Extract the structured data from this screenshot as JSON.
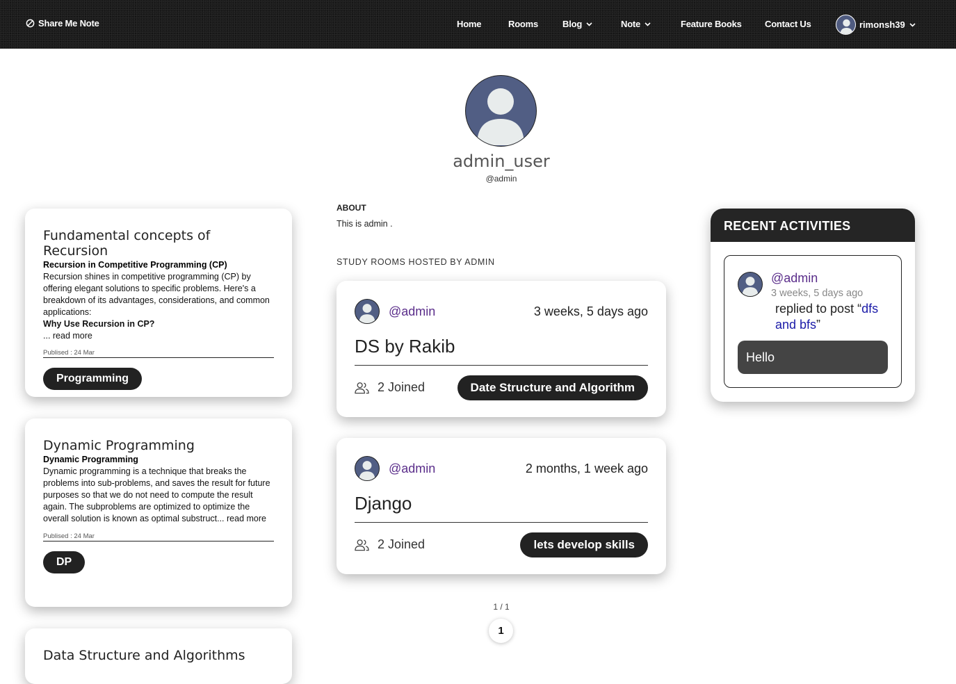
{
  "nav": {
    "brand": "Share Me Note",
    "items": [
      {
        "label": "Home"
      },
      {
        "label": "Rooms"
      },
      {
        "label": "Blog"
      },
      {
        "label": "Note"
      },
      {
        "label": "Feature Books"
      },
      {
        "label": "Contact Us"
      }
    ],
    "user": "rimonsh39",
    "icons": {
      "brand": "leaf-logo-icon",
      "dropdown": "chevron-down-icon",
      "avatar": "default-user-avatar"
    }
  },
  "profile": {
    "name": "admin_user",
    "handle": "@admin"
  },
  "about": {
    "label": "ABOUT",
    "text": "This is admin ."
  },
  "rooms": {
    "label": "STUDY ROOMS HOSTED BY ADMIN",
    "items": [
      {
        "host": "@admin",
        "time": "3 weeks, 5 days ago",
        "title": "DS by Rakib",
        "joined": "2 Joined",
        "topic": "Date Structure and Algorithm"
      },
      {
        "host": "@admin",
        "time": "2 months, 1 week ago",
        "title": "Django",
        "joined": "2 Joined",
        "topic": "lets develop skills"
      }
    ]
  },
  "pagination": {
    "status": "1 / 1",
    "page": "1"
  },
  "blogs": [
    {
      "title": "Fundamental concepts of Recursion",
      "subtitle": "Recursion in Competitive Programming (CP)",
      "body": "Recursion shines in competitive programming (CP) by offering elegant solutions to specific problems. Here's a breakdown of its advantages, considerations, and common applications:",
      "bold_line": "Why Use Recursion in CP?",
      "more": "... read more",
      "published": "Publised : 24 Mar",
      "tag": "Programming"
    },
    {
      "title": "Dynamic Programming",
      "subtitle": "Dynamic Programming",
      "body": "Dynamic programming is a technique that breaks the problems into sub-problems, and saves the result for future purposes so that we do not need to compute the result again. The subproblems are optimized to optimize the overall solution is known as optimal substruct... read more",
      "published": "Publised : 24 Mar",
      "tag": "DP"
    },
    {
      "title": "Data Structure and Algorithms"
    }
  ],
  "activity": {
    "header": "RECENT ACTIVITIES",
    "user": "@admin",
    "time": "3 weeks, 5 days ago",
    "action": "replied to post “",
    "post": "dfs and bfs",
    "close_quote": "”",
    "reply": "Hello"
  },
  "colors": {
    "navbar": "#1c1c1c",
    "accent_user": "#5a2d8a",
    "link": "#1a1aa8",
    "pill": "#222222"
  }
}
